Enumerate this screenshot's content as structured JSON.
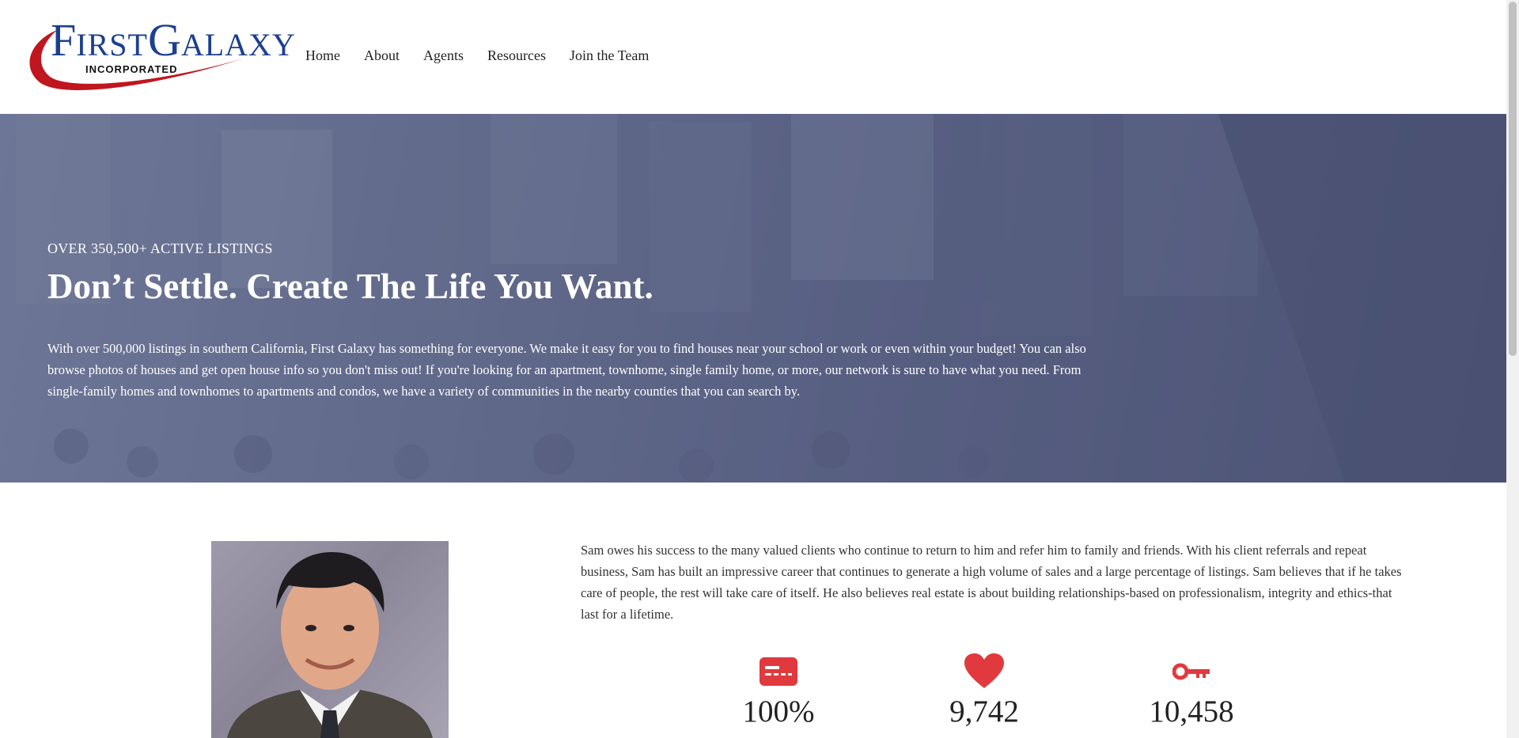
{
  "header": {
    "logo": {
      "first_initial": "F",
      "first_rest": "IRST",
      "galaxy_initial": "G",
      "galaxy_rest": "ALAXY",
      "sub": "INCORPORATED"
    },
    "nav": [
      {
        "label": "Home"
      },
      {
        "label": "About"
      },
      {
        "label": "Agents"
      },
      {
        "label": "Resources"
      },
      {
        "label": "Join the Team"
      }
    ]
  },
  "hero": {
    "kicker": "OVER 350,500+ ACTIVE LISTINGS",
    "title": "Don’t Settle. Create The Life You Want.",
    "text": "With over 500,000 listings in southern California, First Galaxy has something for everyone. We make it easy for you to find houses near your school or work or even within your budget! You can also browse photos of houses and get open house info so you don't miss out! If you're looking for an apartment, townhome, single family home, or more, our network is sure to have what you need. From single-family homes and townhomes to apartments and condos, we have a variety of communities in the nearby counties that you can search by."
  },
  "about": {
    "text": "Sam owes his success to the many valued clients who continue to return to him and refer him to family and friends. With his client referrals and repeat business, Sam has built an impressive career that continues to generate a high volume of sales and a large percentage of listings. Sam believes that if he takes care of people, the rest will take care of itself. He also believes real estate is about building relationships-based on professionalism, integrity and ethics-that last for a lifetime."
  },
  "stats": [
    {
      "icon": "credit-card-icon",
      "value": "100%"
    },
    {
      "icon": "heart-icon",
      "value": "9,742"
    },
    {
      "icon": "key-icon",
      "value": "10,458"
    }
  ],
  "colors": {
    "brand_red": "#c0161f",
    "brand_blue": "#1c3f8f",
    "stat_icon": "#e03a3e"
  }
}
